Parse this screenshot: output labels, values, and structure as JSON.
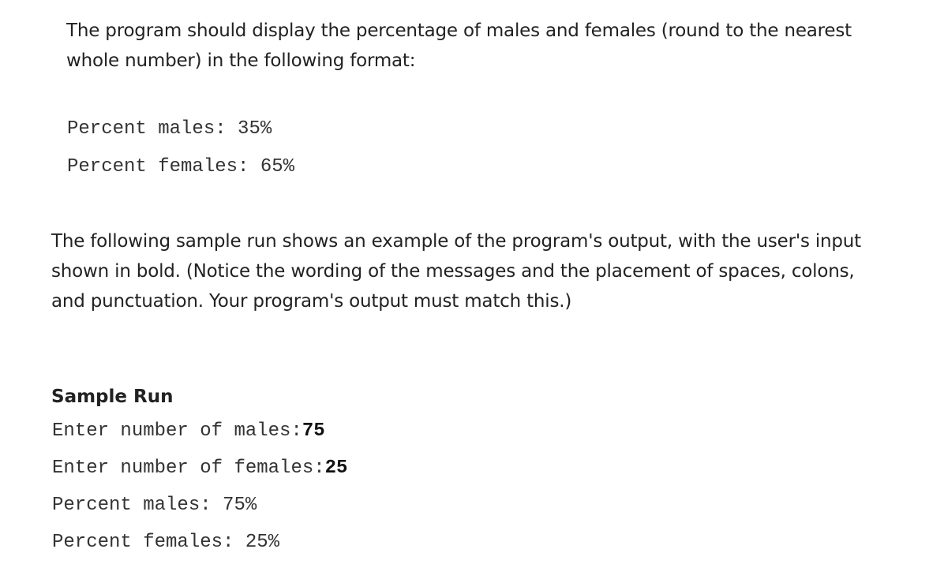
{
  "intro": {
    "text": "The program should display the percentage of males and females (round to the nearest whole number) in the following format:"
  },
  "format_example": {
    "lines": [
      "Percent males: 35%",
      "Percent females: 65%"
    ]
  },
  "sample_description": {
    "text": "The following sample run shows an example of the program's output, with the user's input shown in bold. (Notice the wording of the messages and the placement of spaces, colons, and punctuation. Your program's output must match this.)"
  },
  "sample_run": {
    "title": "Sample Run",
    "prompt_males": "Enter number of males:",
    "input_males": "75",
    "prompt_females": "Enter number of females:",
    "input_females": "25",
    "output_males": "Percent males: 75%",
    "output_females": "Percent females: 25%"
  }
}
